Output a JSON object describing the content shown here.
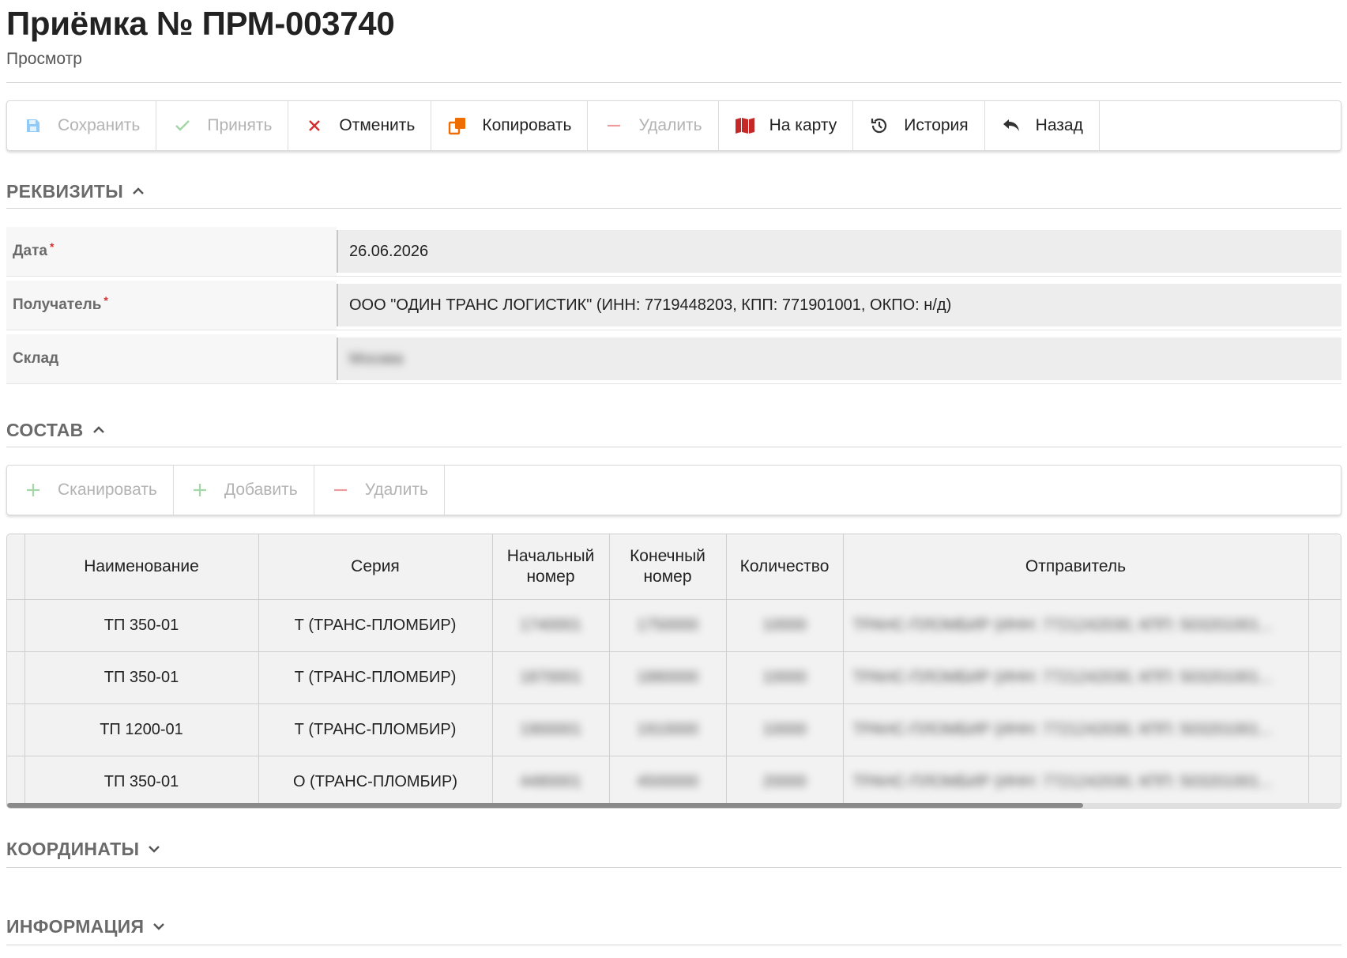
{
  "header": {
    "title": "Приёмка № ПРМ-003740",
    "subtitle": "Просмотр"
  },
  "toolbar": {
    "save": "Сохранить",
    "accept": "Принять",
    "cancel": "Отменить",
    "copy": "Копировать",
    "delete": "Удалить",
    "map": "На карту",
    "history": "История",
    "back": "Назад"
  },
  "requisites": {
    "heading": "РЕКВИЗИТЫ",
    "date_label": "Дата",
    "date_value": "26.06.2026",
    "recipient_label": "Получатель",
    "recipient_value": "ООО \"ОДИН ТРАНС ЛОГИСТИК\" (ИНН: 7719448203, КПП: 771901001, ОКПО: н/д)",
    "warehouse_label": "Склад",
    "warehouse_value": "Москва",
    "required_mark": "*"
  },
  "composition": {
    "heading": "СОСТАВ",
    "scan": "Сканировать",
    "add": "Добавить",
    "delete": "Удалить",
    "columns": [
      "Наименование",
      "Серия",
      "Начальный номер",
      "Конечный номер",
      "Количество",
      "Отправитель"
    ],
    "rows": [
      {
        "name": "ТП 350-01",
        "series": "Т (ТРАНС-ПЛОМБИР)",
        "start": "1740001",
        "end": "1750000",
        "qty": "10000",
        "sender": "ТРАНС-ПЛОМБИР (ИНН: 7721242030, КПП: 503201001..."
      },
      {
        "name": "ТП 350-01",
        "series": "Т (ТРАНС-ПЛОМБИР)",
        "start": "1870001",
        "end": "1880000",
        "qty": "10000",
        "sender": "ТРАНС-ПЛОМБИР (ИНН: 7721242030, КПП: 503201001..."
      },
      {
        "name": "ТП 1200-01",
        "series": "Т (ТРАНС-ПЛОМБИР)",
        "start": "1900001",
        "end": "1910000",
        "qty": "10000",
        "sender": "ТРАНС-ПЛОМБИР (ИНН: 7721242030, КПП: 503201001..."
      },
      {
        "name": "ТП 350-01",
        "series": "О (ТРАНС-ПЛОМБИР)",
        "start": "4480001",
        "end": "4500000",
        "qty": "20000",
        "sender": "ТРАНС-ПЛОМБИР (ИНН: 7721242030, КПП: 503201001..."
      }
    ]
  },
  "coordinates": {
    "heading": "КООРДИНАТЫ"
  },
  "information": {
    "heading": "ИНФОРМАЦИЯ"
  },
  "colors": {
    "disabled_text": "#b3b3b3",
    "cancel_icon": "#d32f2f",
    "copy_icon": "#ef6c00",
    "map_icon": "#c62828",
    "accept_icon": "#a5d6a7",
    "save_icon": "#90caf9",
    "delete_icon": "#ef9a9a"
  }
}
